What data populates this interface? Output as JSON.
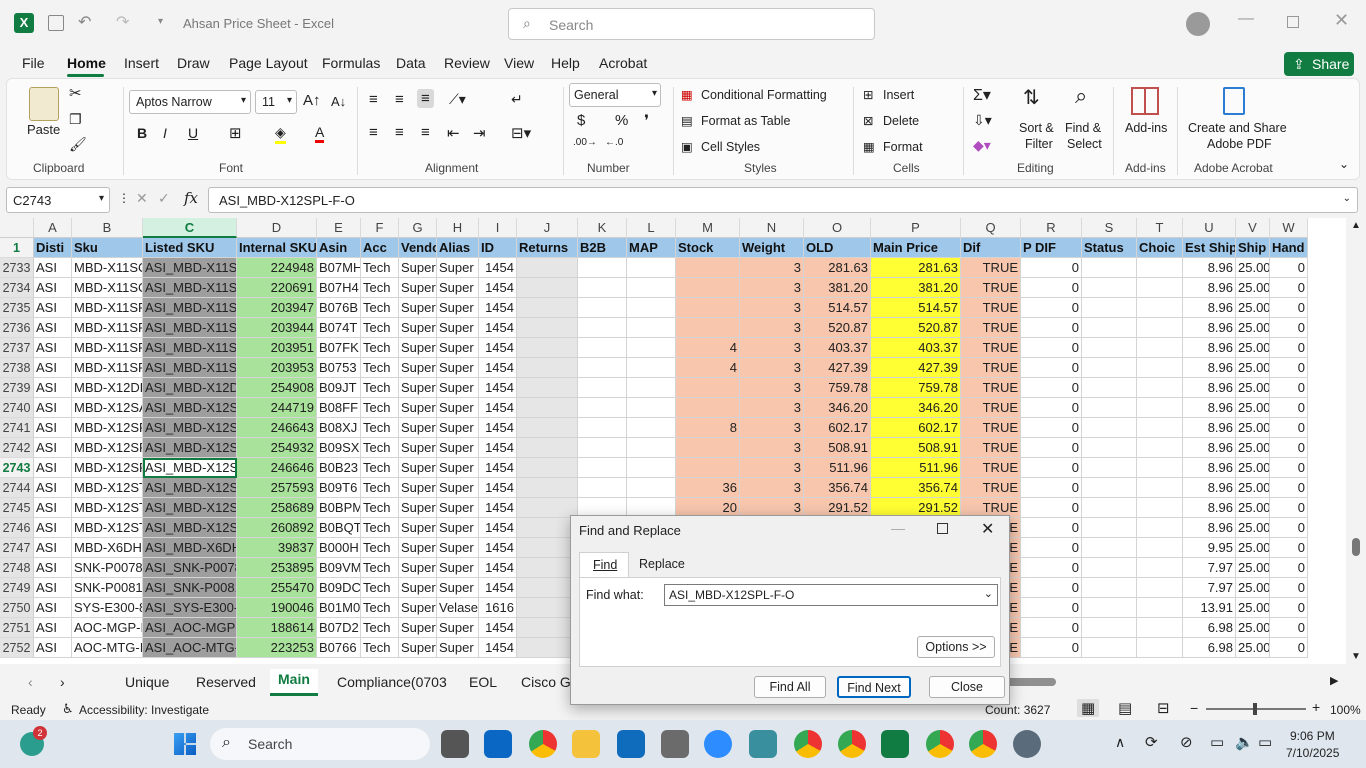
{
  "app": {
    "title": "Ahsan Price Sheet  -  Excel",
    "search_placeholder": "Search",
    "share": "Share"
  },
  "menu": [
    "File",
    "Home",
    "Insert",
    "Draw",
    "Page Layout",
    "Formulas",
    "Data",
    "Review",
    "View",
    "Help",
    "Acrobat"
  ],
  "ribbon": {
    "clipboard": {
      "paste": "Paste",
      "label": "Clipboard"
    },
    "font": {
      "name": "Aptos Narrow",
      "size": "11",
      "label": "Font",
      "bold": "B",
      "italic": "I",
      "underline": "U"
    },
    "alignment": {
      "label": "Alignment"
    },
    "number": {
      "format": "General",
      "label": "Number",
      "currency": "$",
      "percent": "%"
    },
    "styles": {
      "conditional": "Conditional Formatting",
      "format_table": "Format as Table",
      "cell_styles": "Cell Styles",
      "label": "Styles"
    },
    "cells": {
      "insert": "Insert",
      "delete": "Delete",
      "format": "Format",
      "label": "Cells"
    },
    "editing": {
      "sort": "Sort &",
      "filter": "Filter",
      "find": "Find &",
      "select": "Select",
      "label": "Editing"
    },
    "addins": {
      "btn": "Add-ins",
      "label": "Add-ins"
    },
    "acrobat": {
      "btn1": "Create and Share",
      "btn2": "Adobe PDF",
      "label": "Adobe Acrobat"
    }
  },
  "formula_bar": {
    "name_box": "C2743",
    "fx": "fx",
    "content": "ASI_MBD-X12SPL-F-O"
  },
  "columns": [
    "A",
    "B",
    "C",
    "D",
    "E",
    "F",
    "G",
    "H",
    "I",
    "J",
    "K",
    "L",
    "M",
    "N",
    "O",
    "P",
    "Q",
    "R",
    "S",
    "T",
    "U",
    "V",
    "W"
  ],
  "headers": [
    "Disti",
    "Sku",
    "Listed SKU",
    "Internal SKU",
    "Asin",
    "Acc",
    "Vendo",
    "Alias",
    "ID",
    "Returns",
    "B2B",
    "MAP",
    "Stock",
    "Weight",
    "OLD",
    "Main Price",
    "Dif",
    "P DIF",
    "Status",
    "Choic",
    "Est Ship",
    "Ship",
    "Hand"
  ],
  "rows": [
    {
      "n": "2733",
      "a": "ASI",
      "b": "MBD-X11SCL-LN",
      "c": "ASI_MBD-X11S",
      "d": "224948",
      "e": "B07MH",
      "f": "Tech",
      "g": "Super",
      "h": "Super",
      "i": "1454",
      "m": "",
      "nw": "3",
      "o": "281.63",
      "p": "281.63",
      "q": "TRUE",
      "r": "0",
      "u": "8.96",
      "v": "25.00",
      "w": "0"
    },
    {
      "n": "2734",
      "a": "ASI",
      "b": "MBD-X11SCZ-F-",
      "c": "ASI_MBD-X11S",
      "d": "220691",
      "e": "B07H4",
      "f": "Tech",
      "g": "Super",
      "h": "Super",
      "i": "1454",
      "m": "",
      "nw": "3",
      "o": "381.20",
      "p": "381.20",
      "q": "TRUE",
      "r": "0",
      "u": "8.96",
      "v": "25.00",
      "w": "0"
    },
    {
      "n": "2735",
      "a": "ASI",
      "b": "MBD-X11SPI-TF-",
      "c": "ASI_MBD-X11S",
      "d": "203947",
      "e": "B076B",
      "f": "Tech",
      "g": "Super",
      "h": "Super",
      "i": "1454",
      "m": "",
      "nw": "3",
      "o": "514.57",
      "p": "514.57",
      "q": "TRUE",
      "r": "0",
      "u": "8.96",
      "v": "25.00",
      "w": "0"
    },
    {
      "n": "2736",
      "a": "ASI",
      "b": "MBD-X11SPI-TF-",
      "c": "ASI_MBD-X11S",
      "d": "203944",
      "e": "B074T",
      "f": "Tech",
      "g": "Super",
      "h": "Super",
      "i": "1454",
      "m": "",
      "nw": "3",
      "o": "520.87",
      "p": "520.87",
      "q": "TRUE",
      "r": "0",
      "u": "8.96",
      "v": "25.00",
      "w": "0"
    },
    {
      "n": "2737",
      "a": "ASI",
      "b": "MBD-X11SPL-F-",
      "c": "ASI_MBD-X11S",
      "d": "203951",
      "e": "B07FK",
      "f": "Tech",
      "g": "Super",
      "h": "Super",
      "i": "1454",
      "m": "4",
      "nw": "3",
      "o": "403.37",
      "p": "403.37",
      "q": "TRUE",
      "r": "0",
      "u": "8.96",
      "v": "25.00",
      "w": "0"
    },
    {
      "n": "2738",
      "a": "ASI",
      "b": "MBD-X11SPM-F-",
      "c": "ASI_MBD-X11S",
      "d": "203953",
      "e": "B0753",
      "f": "Tech",
      "g": "Super",
      "h": "Super",
      "i": "1454",
      "m": "4",
      "nw": "3",
      "o": "427.39",
      "p": "427.39",
      "q": "TRUE",
      "r": "0",
      "u": "8.96",
      "v": "25.00",
      "w": "0"
    },
    {
      "n": "2739",
      "a": "ASI",
      "b": "MBD-X12DPL-N",
      "c": "ASI_MBD-X12D",
      "d": "254908",
      "e": "B09JT",
      "f": "Tech",
      "g": "Super",
      "h": "Super",
      "i": "1454",
      "m": "",
      "nw": "3",
      "o": "759.78",
      "p": "759.78",
      "q": "TRUE",
      "r": "0",
      "u": "8.96",
      "v": "25.00",
      "w": "0"
    },
    {
      "n": "2740",
      "a": "ASI",
      "b": "MBD-X12SAE-O",
      "c": "ASI_MBD-X12S",
      "d": "244719",
      "e": "B08FF",
      "f": "Tech",
      "g": "Super",
      "h": "Super",
      "i": "1454",
      "m": "",
      "nw": "3",
      "o": "346.20",
      "p": "346.20",
      "q": "TRUE",
      "r": "0",
      "u": "8.96",
      "v": "25.00",
      "w": "0"
    },
    {
      "n": "2741",
      "a": "ASI",
      "b": "MBD-X12SPI-TF-",
      "c": "ASI_MBD-X12S",
      "d": "246643",
      "e": "B08XJ",
      "f": "Tech",
      "g": "Super",
      "h": "Super",
      "i": "1454",
      "m": "8",
      "nw": "3",
      "o": "602.17",
      "p": "602.17",
      "q": "TRUE",
      "r": "0",
      "u": "8.96",
      "v": "25.00",
      "w": "0"
    },
    {
      "n": "2742",
      "a": "ASI",
      "b": "MBD-X12SPL-F-",
      "c": "ASI_MBD-X12S",
      "d": "254932",
      "e": "B09SX",
      "f": "Tech",
      "g": "Super",
      "h": "Super",
      "i": "1454",
      "m": "",
      "nw": "3",
      "o": "508.91",
      "p": "508.91",
      "q": "TRUE",
      "r": "0",
      "u": "8.96",
      "v": "25.00",
      "w": "0"
    },
    {
      "n": "2743",
      "a": "ASI",
      "b": "MBD-X12SPL-F-",
      "c": "ASI_MBD-X12S",
      "d": "246646",
      "e": "B0B23",
      "f": "Tech",
      "g": "Super",
      "h": "Super",
      "i": "1454",
      "m": "",
      "nw": "3",
      "o": "511.96",
      "p": "511.96",
      "q": "TRUE",
      "r": "0",
      "u": "8.96",
      "v": "25.00",
      "w": "0"
    },
    {
      "n": "2744",
      "a": "ASI",
      "b": "MBD-X12STH-F-",
      "c": "ASI_MBD-X12S",
      "d": "257593",
      "e": "B09T6",
      "f": "Tech",
      "g": "Super",
      "h": "Super",
      "i": "1454",
      "m": "36",
      "nw": "3",
      "o": "356.74",
      "p": "356.74",
      "q": "TRUE",
      "r": "0",
      "u": "8.96",
      "v": "25.00",
      "w": "0"
    },
    {
      "n": "2745",
      "a": "ASI",
      "b": "MBD-X12STL-F-",
      "c": "ASI_MBD-X12S",
      "d": "258689",
      "e": "B0BPM",
      "f": "Tech",
      "g": "Super",
      "h": "Super",
      "i": "1454",
      "m": "20",
      "nw": "3",
      "o": "291.52",
      "p": "291.52",
      "q": "TRUE",
      "r": "0",
      "u": "8.96",
      "v": "25.00",
      "w": "0"
    },
    {
      "n": "2746",
      "a": "ASI",
      "b": "MBD-X12STL-IF-",
      "c": "ASI_MBD-X12S",
      "d": "260892",
      "e": "B0BQT",
      "f": "Tech",
      "g": "Super",
      "h": "Super",
      "i": "1454",
      "m": "",
      "nw": "",
      "o": "",
      "p": "",
      "q": "TRUE",
      "r": "0",
      "u": "8.96",
      "v": "25.00",
      "w": "0"
    },
    {
      "n": "2747",
      "a": "ASI",
      "b": "MBD-X6DHR-8G",
      "c": "ASI_MBD-X6DH",
      "d": "39837",
      "e": "B000H",
      "f": "Tech",
      "g": "Super",
      "h": "Super",
      "i": "1454",
      "m": "",
      "nw": "",
      "o": "",
      "p": "",
      "q": "TRUE",
      "r": "0",
      "u": "9.95",
      "v": "25.00",
      "w": "0"
    },
    {
      "n": "2748",
      "a": "ASI",
      "b": "SNK-P0078AP4",
      "c": "ASI_SNK-P0078",
      "d": "253895",
      "e": "B09VM",
      "f": "Tech",
      "g": "Super",
      "h": "Super",
      "i": "1454",
      "m": "",
      "nw": "",
      "o": "",
      "p": "",
      "q": "TRUE",
      "r": "0",
      "u": "7.97",
      "v": "25.00",
      "w": "0"
    },
    {
      "n": "2749",
      "a": "ASI",
      "b": "SNK-P0081AP4",
      "c": "ASI_SNK-P0081",
      "d": "255470",
      "e": "B09DC",
      "f": "Tech",
      "g": "Super",
      "h": "Super",
      "i": "1454",
      "m": "",
      "nw": "",
      "o": "",
      "p": "",
      "q": "TRUE",
      "r": "0",
      "u": "7.97",
      "v": "25.00",
      "w": "0"
    },
    {
      "n": "2750",
      "a": "ASI",
      "b": "SYS-E300-8D",
      "c": "ASI_SYS-E300-8",
      "d": "190046",
      "e": "B01M0",
      "f": "Tech",
      "g": "Super",
      "h": "Velase",
      "i": "1616",
      "m": "",
      "nw": "",
      "o": "",
      "p": "",
      "q": "TRUE",
      "r": "0",
      "u": "13.91",
      "v": "25.00",
      "w": "0"
    },
    {
      "n": "2751",
      "a": "ASI",
      "b": "AOC-MGP-I2M-",
      "c": "ASI_AOC-MGP-",
      "d": "188614",
      "e": "B07D2",
      "f": "Tech",
      "g": "Super",
      "h": "Super",
      "i": "1454",
      "m": "",
      "nw": "",
      "o": "",
      "p": "",
      "q": "TRUE",
      "r": "0",
      "u": "6.98",
      "v": "25.00",
      "w": "0"
    },
    {
      "n": "2752",
      "a": "ASI",
      "b": "AOC-MTG-I2T-C",
      "c": "ASI_AOC-MTG-",
      "d": "223253",
      "e": "B0766",
      "f": "Tech",
      "g": "Super",
      "h": "Super",
      "i": "1454",
      "m": "",
      "nw": "",
      "o": "",
      "p": "",
      "q": "TRUE",
      "r": "0",
      "u": "6.98",
      "v": "25.00",
      "w": "0"
    }
  ],
  "sheets": [
    "Unique",
    "Reserved",
    "Main",
    "Compliance(0703",
    "EOL",
    "Cisco Ga"
  ],
  "status": {
    "ready": "Ready",
    "accessibility": "Accessibility: Investigate",
    "count": "Count: 3627",
    "zoom": "100%"
  },
  "dialog": {
    "title": "Find and Replace",
    "tab_find": "Find",
    "tab_replace": "Replace",
    "find_label": "Find what:",
    "find_value": "ASI_MBD-X12SPL-F-O",
    "options": "Options >>",
    "find_all": "Find All",
    "find_next": "Find Next",
    "close": "Close"
  },
  "taskbar": {
    "search": "Search",
    "badge": "2",
    "time": "9:06 PM",
    "date": "7/10/2025"
  }
}
